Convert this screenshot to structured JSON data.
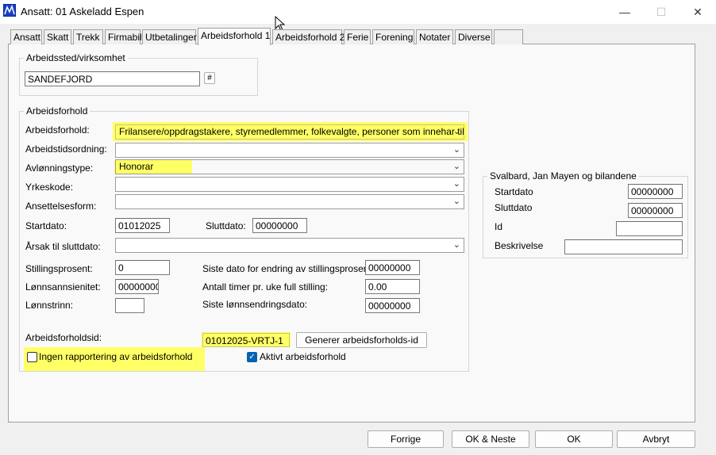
{
  "window": {
    "title": "Ansatt: 01 Askeladd Espen",
    "minimize": "—",
    "maximize": "☐",
    "close": "✕"
  },
  "tabs": [
    {
      "label": "Ansatt"
    },
    {
      "label": "Skatt"
    },
    {
      "label": "Trekk"
    },
    {
      "label": "Firmabil"
    },
    {
      "label": "Utbetalinger"
    },
    {
      "label": "Arbeidsforhold 1"
    },
    {
      "label": "Arbeidsforhold 2"
    },
    {
      "label": "Ferie"
    },
    {
      "label": "Forening"
    },
    {
      "label": "Notater"
    },
    {
      "label": "Diverse"
    },
    {
      "label": ""
    }
  ],
  "workplace": {
    "group_label": "Arbeidssted/virksomhet",
    "value": "SANDEFJORD",
    "hash_button": "#"
  },
  "employment": {
    "group_label": "Arbeidsforhold",
    "arbeidsforhold_label": "Arbeidsforhold:",
    "arbeidsforhold_value": "Frilansere/oppdragstakere, styremedlemmer, folkevalgte, personer som innehar tillitsv",
    "arbeidstidsordning_label": "Arbeidstidsordning:",
    "arbeidstidsordning_value": "",
    "avlonningstype_label": "Avlønningstype:",
    "avlonningstype_value": "Honorar",
    "yrkeskode_label": "Yrkeskode:",
    "yrkeskode_value": "",
    "ansettelsesform_label": "Ansettelsesform:",
    "ansettelsesform_value": "",
    "startdato_label": "Startdato:",
    "startdato_value": "01012025",
    "sluttdato_label": "Sluttdato:",
    "sluttdato_value": "00000000",
    "arsak_label": "Årsak til sluttdato:",
    "arsak_value": "",
    "stillingsprosent_label": "Stillingsprosent:",
    "stillingsprosent_value": "0",
    "lonnsansiennitet_label": "Lønnsannsienitet:",
    "lonnsansiennitet_value": "00000000",
    "lonnstrinn_label": "Lønnstrinn:",
    "lonnstrinn_value": "",
    "siste_endring_stilling_label": "Siste dato for endring av stillingsprosent:",
    "siste_endring_stilling_value": "00000000",
    "antall_timer_label": "Antall timer pr. uke full stilling:",
    "antall_timer_value": "0.00",
    "siste_lonnsendring_label": "Siste lønnsendringsdato:",
    "siste_lonnsendring_value": "00000000",
    "arbeidsforholdsid_label": "Arbeidsforholdsid:",
    "arbeidsforholdsid_value": "01012025-VRTJ-1",
    "generer_button": "Generer arbeidsforholds-id",
    "ingen_rapportering_label": "Ingen rapportering av arbeidsforhold",
    "ingen_rapportering_checked": false,
    "aktivt_label": "Aktivt arbeidsforhold",
    "aktivt_checked": true
  },
  "svalbard": {
    "group_label": "Svalbard, Jan Mayen og bilandene",
    "startdato_label": "Startdato",
    "startdato_value": "00000000",
    "sluttdato_label": "Sluttdato",
    "sluttdato_value": "00000000",
    "id_label": "Id",
    "id_value": "",
    "beskrivelse_label": "Beskrivelse",
    "beskrivelse_value": ""
  },
  "footer": {
    "forrige": "Forrige",
    "ok_neste": "OK & Neste",
    "ok": "OK",
    "avbryt": "Avbryt"
  },
  "colors": {
    "highlight": "#ffff66",
    "check_accent": "#0063b1"
  }
}
